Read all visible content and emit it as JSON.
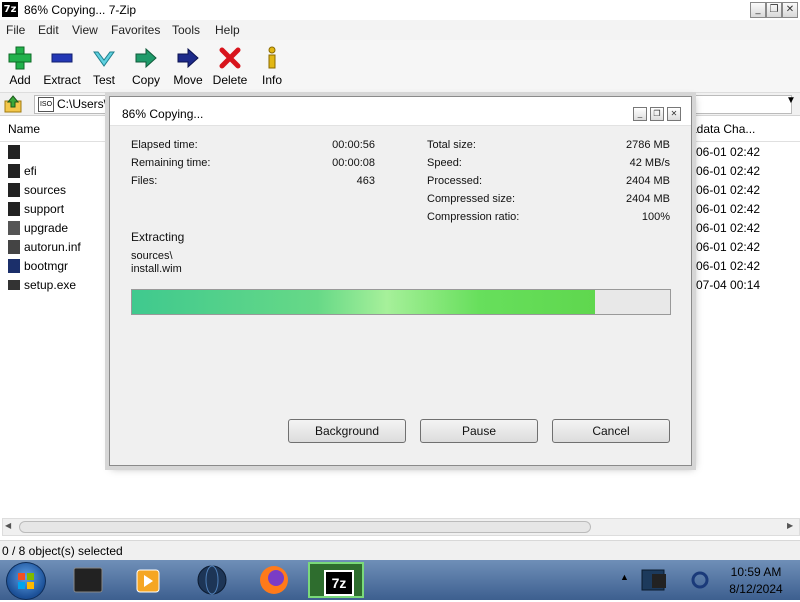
{
  "window": {
    "title": "86% Copying... 7-Zip",
    "app_logo": "7z"
  },
  "menu": [
    "File",
    "Edit",
    "View",
    "Favorites",
    "Tools",
    "Help"
  ],
  "toolbar": [
    {
      "label": "Add",
      "icon": "plus-icon"
    },
    {
      "label": "Extract",
      "icon": "minus-icon"
    },
    {
      "label": "Test",
      "icon": "check-icon"
    },
    {
      "label": "Copy",
      "icon": "copy-arrow-icon"
    },
    {
      "label": "Move",
      "icon": "move-arrow-icon"
    },
    {
      "label": "Delete",
      "icon": "delete-x-icon"
    },
    {
      "label": "Info",
      "icon": "info-icon"
    }
  ],
  "address": {
    "path": "C:\\Users\\",
    "drive_icon_text": "ISO"
  },
  "filelist": {
    "col_name": "Name",
    "col_modified": "adata Cha...",
    "rows": [
      {
        "name": "",
        "date": "-06-01 02:42"
      },
      {
        "name": "efi",
        "date": "-06-01 02:42"
      },
      {
        "name": "sources",
        "date": "-06-01 02:42"
      },
      {
        "name": "support",
        "date": "-06-01 02:42"
      },
      {
        "name": "upgrade",
        "date": "-06-01 02:42"
      },
      {
        "name": "autorun.inf",
        "date": "-06-01 02:42"
      },
      {
        "name": "bootmgr",
        "date": "-06-01 02:42"
      },
      {
        "name": "setup.exe",
        "date": "-07-04 00:14"
      }
    ]
  },
  "status": {
    "text": "0 / 8 object(s) selected"
  },
  "dialog": {
    "title": "86% Copying...",
    "elapsed_label": "Elapsed time:",
    "elapsed": "00:00:56",
    "remaining_label": "Remaining time:",
    "remaining": "00:00:08",
    "files_label": "Files:",
    "files": "463",
    "total_label": "Total size:",
    "total": "2786 MB",
    "speed_label": "Speed:",
    "speed": "42 MB/s",
    "processed_label": "Processed:",
    "processed": "2404 MB",
    "compressed_label": "Compressed size:",
    "compressed": "2404 MB",
    "ratio_label": "Compression ratio:",
    "ratio": "100%",
    "operation": "Extracting",
    "current_dir": "sources\\",
    "current_file": "install.wim",
    "progress_percent": 86,
    "buttons": {
      "background": "Background",
      "pause": "Pause",
      "cancel": "Cancel"
    }
  },
  "taskbar": {
    "apps": [
      "file-manager-icon",
      "media-player-icon",
      "network-globe-icon",
      "firefox-icon",
      "7zip-icon"
    ],
    "active_app_label": "7z",
    "time": "10:59 AM",
    "date": "8/12/2024"
  },
  "colors": {
    "progress": "#5fd74e",
    "taskbar": "#3d5f8f"
  }
}
